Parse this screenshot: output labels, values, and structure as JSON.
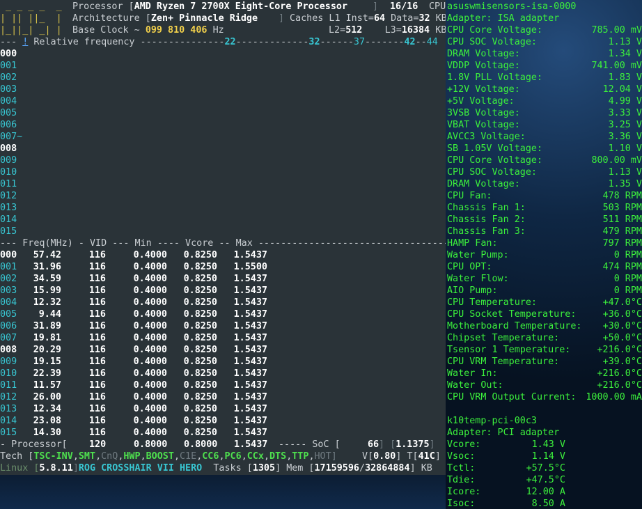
{
  "left": {
    "logo": {
      "line1": " _ _ _ _  _",
      "line2": "| || ||_  |",
      "line3": "|_||_| _| |"
    },
    "processor": {
      "label": "Processor [",
      "value": "AMD Ryzen 7 2700X Eight-Core Processor",
      "close": "]",
      "threads": "16/16",
      "cpu_label": "CPU"
    },
    "architecture": {
      "label": "Architecture [",
      "value": "Zen+ Pinnacle Ridge",
      "close": "]",
      "caches_label": "Caches L1 Inst=",
      "l1_inst": "64",
      "data_label": "Data=",
      "l1_data": "32",
      "kb": "KB"
    },
    "base_clock": {
      "label": "Base Clock ~ ",
      "value": "099 810 406",
      "unit": "Hz",
      "l2_label": "L2=",
      "l2": "512",
      "l3_label": "L3=",
      "l3": "16384",
      "kb": "KB"
    },
    "freq_header": {
      "prefix": "--- ",
      "marker": "!",
      "label": " Relative frequency ---------------",
      "t22": "22",
      "dash1": "-------------",
      "t32": "32",
      "dash2": "------",
      "t37": "37",
      "dash3": "-------",
      "t42": "42",
      "dash4": "--",
      "t44": "44"
    },
    "graph_cores": [
      "000",
      "001",
      "002",
      "003",
      "004",
      "005",
      "006",
      "007~",
      "008",
      "009",
      "010",
      "011",
      "012",
      "013",
      "014",
      "015"
    ],
    "table_header": "--- Freq(MHz) - VID --- Min ---- Vcore -- Max ---------------------------------------",
    "cores": [
      {
        "id": "000",
        "freq": "57.42",
        "vid": "116",
        "min": "0.4000",
        "vcore": "0.8250",
        "max": "1.5437"
      },
      {
        "id": "001",
        "freq": "31.96",
        "vid": "116",
        "min": "0.4000",
        "vcore": "0.8250",
        "max": "1.5500"
      },
      {
        "id": "002",
        "freq": "34.59",
        "vid": "116",
        "min": "0.4000",
        "vcore": "0.8250",
        "max": "1.5437"
      },
      {
        "id": "003",
        "freq": "15.99",
        "vid": "116",
        "min": "0.4000",
        "vcore": "0.8250",
        "max": "1.5437"
      },
      {
        "id": "004",
        "freq": "12.32",
        "vid": "116",
        "min": "0.4000",
        "vcore": "0.8250",
        "max": "1.5437"
      },
      {
        "id": "005",
        "freq": "9.44",
        "vid": "116",
        "min": "0.4000",
        "vcore": "0.8250",
        "max": "1.5437"
      },
      {
        "id": "006",
        "freq": "31.89",
        "vid": "116",
        "min": "0.4000",
        "vcore": "0.8250",
        "max": "1.5437"
      },
      {
        "id": "007",
        "freq": "19.81",
        "vid": "116",
        "min": "0.4000",
        "vcore": "0.8250",
        "max": "1.5437"
      },
      {
        "id": "008",
        "freq": "20.29",
        "vid": "116",
        "min": "0.4000",
        "vcore": "0.8250",
        "max": "1.5437"
      },
      {
        "id": "009",
        "freq": "19.15",
        "vid": "116",
        "min": "0.4000",
        "vcore": "0.8250",
        "max": "1.5437"
      },
      {
        "id": "010",
        "freq": "22.39",
        "vid": "116",
        "min": "0.4000",
        "vcore": "0.8250",
        "max": "1.5437"
      },
      {
        "id": "011",
        "freq": "11.57",
        "vid": "116",
        "min": "0.4000",
        "vcore": "0.8250",
        "max": "1.5437"
      },
      {
        "id": "012",
        "freq": "26.00",
        "vid": "116",
        "min": "0.4000",
        "vcore": "0.8250",
        "max": "1.5437"
      },
      {
        "id": "013",
        "freq": "12.34",
        "vid": "116",
        "min": "0.4000",
        "vcore": "0.8250",
        "max": "1.5437"
      },
      {
        "id": "014",
        "freq": "23.08",
        "vid": "116",
        "min": "0.4000",
        "vcore": "0.8250",
        "max": "1.5437"
      },
      {
        "id": "015",
        "freq": "14.30",
        "vid": "116",
        "min": "0.4000",
        "vcore": "0.8250",
        "max": "1.5437"
      }
    ],
    "processor_summary": {
      "label": "- Processor[",
      "vid": "120",
      "min": "0.8000",
      "vcore": "0.8000",
      "max": "1.5437",
      "soc_label": "----- SoC [",
      "soc_val": "66",
      "soc_volt": "1.1375"
    },
    "tech": {
      "label": "Tech [",
      "items": [
        "TSC-INV",
        "SMT",
        "CnQ",
        "HWP",
        "BOOST",
        "C1E",
        "CC6",
        "PC6",
        "CCx",
        "DTS",
        "TTP",
        "HOT"
      ],
      "v_label": "V[",
      "v_value": "0.80",
      "t_label": "T[",
      "t_value": "41C"
    },
    "linux": {
      "label": "Linux [",
      "kernel": "5.8.11",
      "board": "ROG CROSSHAIR VII HERO",
      "tasks_label": "Tasks [",
      "tasks": "1305",
      "mem_label": "Mem [",
      "mem_used": "17159596",
      "mem_total": "32864884",
      "kb": "KB"
    }
  },
  "right": {
    "header": "asuswmisensors-isa-0000",
    "adapter": "Adapter: ISA adapter",
    "readings": [
      {
        "label": "CPU Core Voltage:",
        "value": "785.00 mV"
      },
      {
        "label": "CPU SOC Voltage:",
        "value": "1.13 V"
      },
      {
        "label": "DRAM Voltage:",
        "value": "1.34 V"
      },
      {
        "label": "VDDP Voltage:",
        "value": "741.00 mV"
      },
      {
        "label": "1.8V PLL Voltage:",
        "value": "1.83 V"
      },
      {
        "label": "+12V Voltage:",
        "value": "12.04 V"
      },
      {
        "label": "+5V Voltage:",
        "value": "4.99 V"
      },
      {
        "label": "3VSB Voltage:",
        "value": "3.33 V"
      },
      {
        "label": "VBAT Voltage:",
        "value": "3.25 V"
      },
      {
        "label": "AVCC3 Voltage:",
        "value": "3.36 V"
      },
      {
        "label": "SB 1.05V Voltage:",
        "value": "1.10 V"
      },
      {
        "label": "CPU Core Voltage:",
        "value": "800.00 mV"
      },
      {
        "label": "CPU SOC Voltage:",
        "value": "1.13 V"
      },
      {
        "label": "DRAM Voltage:",
        "value": "1.35 V"
      },
      {
        "label": "CPU Fan:",
        "value": "478 RPM"
      },
      {
        "label": "Chassis Fan 1:",
        "value": "503 RPM"
      },
      {
        "label": "Chassis Fan 2:",
        "value": "511 RPM"
      },
      {
        "label": "Chassis Fan 3:",
        "value": "479 RPM"
      },
      {
        "label": "HAMP Fan:",
        "value": "797 RPM"
      },
      {
        "label": "Water Pump:",
        "value": "0 RPM"
      },
      {
        "label": "CPU OPT:",
        "value": "474 RPM"
      },
      {
        "label": "Water Flow:",
        "value": "0 RPM"
      },
      {
        "label": "AIO Pump:",
        "value": "0 RPM"
      },
      {
        "label": "CPU Temperature:",
        "value": "+47.0°C"
      },
      {
        "label": "CPU Socket Temperature:",
        "value": "+36.0°C"
      },
      {
        "label": "Motherboard Temperature:",
        "value": "+30.0°C"
      },
      {
        "label": "Chipset Temperature:",
        "value": "+50.0°C"
      },
      {
        "label": "Tsensor 1 Temperature:",
        "value": "+216.0°C"
      },
      {
        "label": "CPU VRM Temperature:",
        "value": "+39.0°C"
      },
      {
        "label": "Water In:",
        "value": "+216.0°C"
      },
      {
        "label": "Water Out:",
        "value": "+216.0°C"
      },
      {
        "label": "CPU VRM Output Current:",
        "value": "1000.00 mA"
      }
    ],
    "k10_header": "k10temp-pci-00c3",
    "k10_adapter": "Adapter: PCI adapter",
    "k10_readings": [
      {
        "label": "Vcore:",
        "value": "1.43 V"
      },
      {
        "label": "Vsoc:",
        "value": "1.14 V"
      },
      {
        "label": "Tctl:",
        "value": "+57.5°C"
      },
      {
        "label": "Tdie:",
        "value": "+47.5°C"
      },
      {
        "label": "Icore:",
        "value": "12.00 A"
      },
      {
        "label": "Isoc:",
        "value": "8.50 A"
      }
    ]
  }
}
